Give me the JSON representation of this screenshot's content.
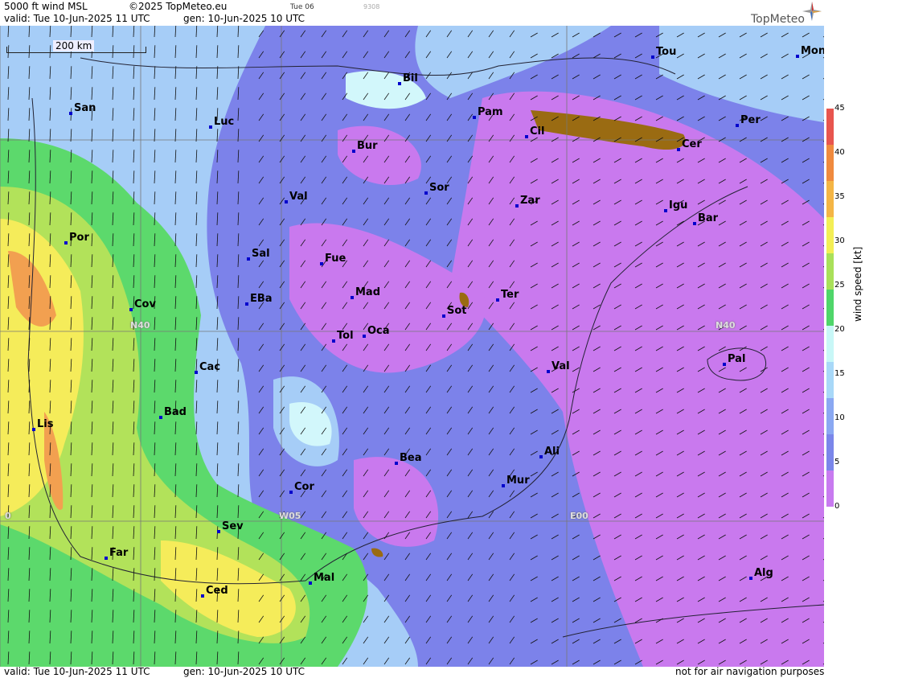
{
  "header": {
    "product": "5000 ft wind MSL",
    "copyright": "©2025 TopMeteo.eu",
    "small_code": "Tue 06",
    "tiny_code": "9308",
    "valid": "valid:  Tue  10-Jun-2025  11 UTC",
    "gen": "gen: 10-Jun-2025 10 UTC",
    "logo": "TopMeteo"
  },
  "footer": {
    "valid": "valid:  Tue  10-Jun-2025  11 UTC",
    "gen": "gen: 10-Jun-2025 10 UTC",
    "note": "not for air navigation purposes"
  },
  "scale_bar": {
    "label": "200 km"
  },
  "grid_labels": {
    "lat_label": "N40",
    "lat_label_right": "N40",
    "lon_w05": "W05",
    "lon_e00": "E00",
    "lon_w10": "0"
  },
  "cities": [
    {
      "name": "San"
    },
    {
      "name": "Luc"
    },
    {
      "name": "Bil"
    },
    {
      "name": "Pam"
    },
    {
      "name": "Tou"
    },
    {
      "name": "Mon"
    },
    {
      "name": "Cil"
    },
    {
      "name": "Per"
    },
    {
      "name": "Bur"
    },
    {
      "name": "Cer"
    },
    {
      "name": "Sor"
    },
    {
      "name": "Val"
    },
    {
      "name": "Zar"
    },
    {
      "name": "Igu"
    },
    {
      "name": "Bar"
    },
    {
      "name": "Por"
    },
    {
      "name": "Sal"
    },
    {
      "name": "Fue"
    },
    {
      "name": "Mad"
    },
    {
      "name": "Cov"
    },
    {
      "name": "EBa"
    },
    {
      "name": "Ter"
    },
    {
      "name": "Sot"
    },
    {
      "name": "Tol"
    },
    {
      "name": "Oca"
    },
    {
      "name": "Pal"
    },
    {
      "name": "Cac"
    },
    {
      "name": "Val"
    },
    {
      "name": "Bad"
    },
    {
      "name": "Lis"
    },
    {
      "name": "Bea"
    },
    {
      "name": "Ali"
    },
    {
      "name": "Mur"
    },
    {
      "name": "Cor"
    },
    {
      "name": "Sev"
    },
    {
      "name": "Far"
    },
    {
      "name": "Alg"
    },
    {
      "name": "Mal"
    },
    {
      "name": "Ced"
    }
  ],
  "legend": {
    "title": "wind speed  [kt]",
    "ticks": [
      "45",
      "40",
      "35",
      "30",
      "25",
      "20",
      "15",
      "10",
      "5",
      "0"
    ],
    "colors": [
      "#e8554e",
      "#f08a3e",
      "#f4b545",
      "#f3ee55",
      "#a9e05a",
      "#4fd66a",
      "#c8f7f7",
      "#a8d8f8",
      "#8aa8f2",
      "#7a86ea",
      "#c87af0"
    ]
  },
  "map_colors": {
    "calm": "#c979ee",
    "light": "#7c82ea",
    "moderate": "#a6cdf7",
    "fresh": "#d2f7fb",
    "strong": "#5cd96c",
    "stronger": "#b2e25a",
    "yellow": "#f5ec5a",
    "orange": "#f2a050",
    "terrain": "#9a6b12"
  }
}
